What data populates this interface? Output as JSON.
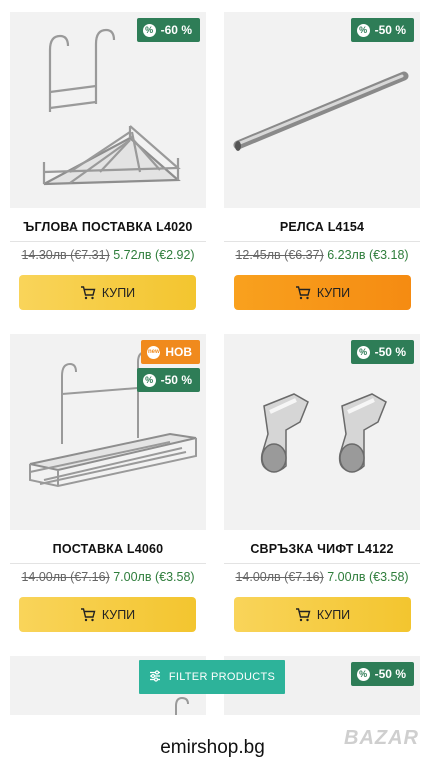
{
  "products": [
    {
      "title": "ЪГЛОВА ПОСТАВКА L4020",
      "old_price": "14.30лв (€7.31)",
      "new_price": "5.72лв (€2.92)",
      "badges": [
        "-60 %"
      ],
      "buy_label": "КУПИ"
    },
    {
      "title": "РЕЛСА L4154",
      "old_price": "12.45лв (€6.37)",
      "new_price": "6.23лв (€3.18)",
      "badges": [
        "-50 %"
      ],
      "buy_label": "КУПИ"
    },
    {
      "title": "ПОСТАВКА L4060",
      "old_price": "14.00лв (€7.16)",
      "new_price": "7.00лв (€3.58)",
      "badges": [
        "НОВ",
        "-50 %"
      ],
      "buy_label": "КУПИ"
    },
    {
      "title": "СВРЪЗКА ЧИФТ L4122",
      "old_price": "14.00лв (€7.16)",
      "new_price": "7.00лв (€3.58)",
      "badges": [
        "-50 %"
      ],
      "buy_label": "КУПИ"
    },
    {
      "badges": []
    },
    {
      "badges": [
        "-50 %"
      ]
    }
  ],
  "new_badge_icon_text": "new",
  "filter_button": {
    "label": "FILTER PRODUCTS",
    "icon": "sliders-icon"
  },
  "footer": {
    "site": "emirshop.bg",
    "watermark": "BAZAR"
  },
  "colors": {
    "discount_badge": "#2e7d57",
    "new_badge": "#f08a1d",
    "buy_button": "#f6cb3c",
    "buy_button_active": "#f6931a",
    "filter_button": "#2db39a"
  }
}
